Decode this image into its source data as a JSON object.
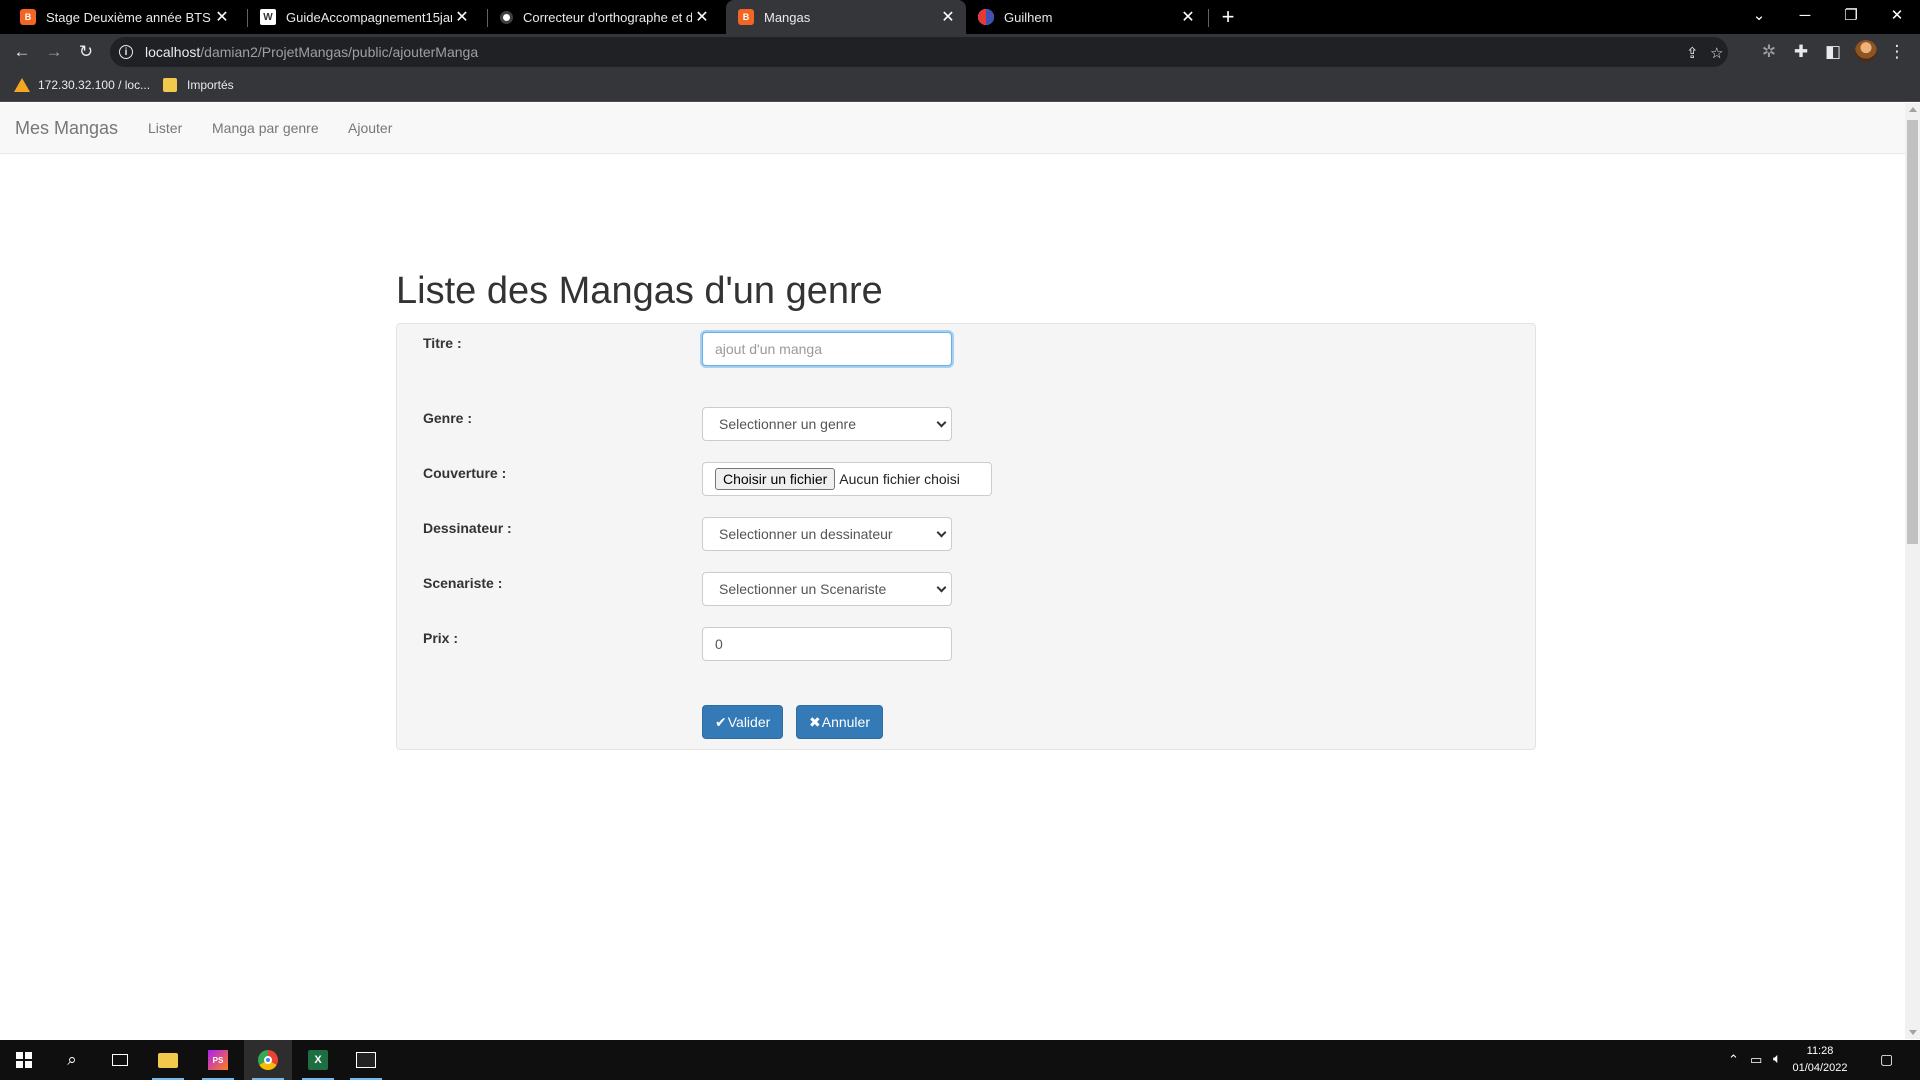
{
  "browser": {
    "tabs": [
      {
        "title": "Stage Deuxième année BTS",
        "favicon": "orange-app-icon"
      },
      {
        "title": "GuideAccompagnement15janv.p",
        "favicon": "document-icon"
      },
      {
        "title": "Correcteur d'orthographe et de g",
        "favicon": "globe-icon"
      },
      {
        "title": "Mangas",
        "favicon": "orange-app-icon"
      },
      {
        "title": "Guilhem",
        "favicon": "discord-icon"
      }
    ],
    "url_host": "localhost",
    "url_path": "/damian2/ProjetMangas/public/ajouterManga",
    "bookmarks": [
      {
        "label": "172.30.32.100 / loc...",
        "icon": "warning-icon"
      },
      {
        "label": "Importés",
        "icon": "folder-icon"
      }
    ]
  },
  "navbar": {
    "brand": "Mes Mangas",
    "links": [
      "Lister",
      "Manga par genre",
      "Ajouter"
    ]
  },
  "page": {
    "title": "Liste des Mangas d'un genre"
  },
  "form": {
    "titre_label": "Titre :",
    "titre_placeholder": "ajout d'un manga",
    "genre_label": "Genre :",
    "genre_selected": "Selectionner un genre",
    "couverture_label": "Couverture :",
    "file_button": "Choisir un fichier",
    "file_status": "Aucun fichier choisi",
    "dessinateur_label": "Dessinateur :",
    "dessinateur_selected": "Selectionner un dessinateur",
    "scenariste_label": "Scenariste :",
    "scenariste_selected": "Selectionner un Scenariste",
    "prix_label": "Prix :",
    "prix_value": "0",
    "valider": "Valider",
    "annuler": "Annuler"
  },
  "taskbar": {
    "time": "11:28",
    "date": "01/04/2022"
  },
  "colors": {
    "primary_button": "#337ab7",
    "navbar_bg": "#f8f8f8",
    "well_bg": "#f5f5f5"
  }
}
